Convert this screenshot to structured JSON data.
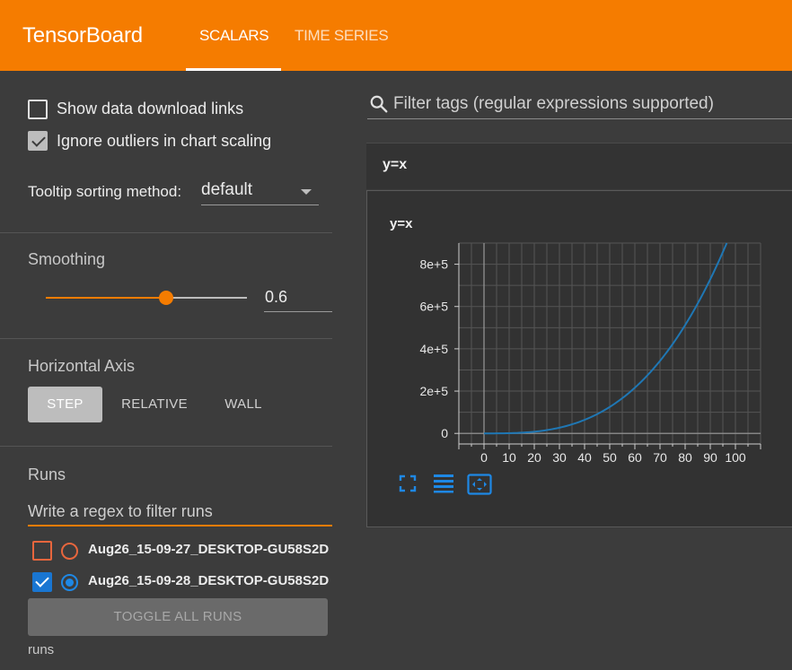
{
  "header": {
    "brand": "TensorBoard",
    "tabs": [
      {
        "label": "SCALARS",
        "active": true
      },
      {
        "label": "TIME SERIES",
        "active": false
      }
    ],
    "color": "#f57c00"
  },
  "sidebar": {
    "options": {
      "show_download_links": {
        "label": "Show data download links",
        "checked": false
      },
      "ignore_outliers": {
        "label": "Ignore outliers in chart scaling",
        "checked": true
      }
    },
    "tooltip_sorting": {
      "label": "Tooltip sorting method:",
      "value": "default"
    },
    "smoothing": {
      "title": "Smoothing",
      "value": "0.6",
      "level": 0.6
    },
    "horizontal_axis": {
      "title": "Horizontal Axis",
      "options": [
        {
          "label": "STEP",
          "selected": true
        },
        {
          "label": "RELATIVE",
          "selected": false
        },
        {
          "label": "WALL",
          "selected": false
        }
      ]
    },
    "runs": {
      "title": "Runs",
      "filter_placeholder": "Write a regex to filter runs",
      "items": [
        {
          "name": "Aug26_15-09-27_DESKTOP-GU58S2D",
          "checked": false,
          "radio_selected": false,
          "color": "#e8663d"
        },
        {
          "name": "Aug26_15-09-28_DESKTOP-GU58S2D",
          "checked": true,
          "radio_selected": true,
          "color": "#1976d2"
        }
      ],
      "toggle_all_label": "TOGGLE ALL RUNS",
      "footer": "runs"
    }
  },
  "main": {
    "filter_placeholder": "Filter tags (regular expressions supported)",
    "card": {
      "group_title": "y=x",
      "chart_title": "y=x",
      "icons": [
        "fullscreen-icon",
        "toggle-log-scale-icon",
        "fit-domain-icon"
      ]
    }
  },
  "chart_data": {
    "type": "line",
    "title": "y=x",
    "xlabel": "",
    "ylabel": "",
    "x_ticks": [
      "0",
      "10",
      "20",
      "30",
      "40",
      "50",
      "60",
      "70",
      "80",
      "90",
      "100"
    ],
    "y_ticks": [
      "0",
      "2e+5",
      "4e+5",
      "6e+5",
      "8e+5"
    ],
    "xlim": [
      -10,
      110
    ],
    "ylim": [
      -50000,
      900000
    ],
    "grid": true,
    "series": [
      {
        "color": "#1f77b4",
        "x": [
          0,
          10,
          20,
          30,
          40,
          50,
          60,
          70,
          80,
          90,
          97
        ],
        "y": [
          0,
          1000,
          8000,
          27000,
          64000,
          125000,
          216000,
          343000,
          512000,
          729000,
          900000
        ]
      }
    ]
  }
}
